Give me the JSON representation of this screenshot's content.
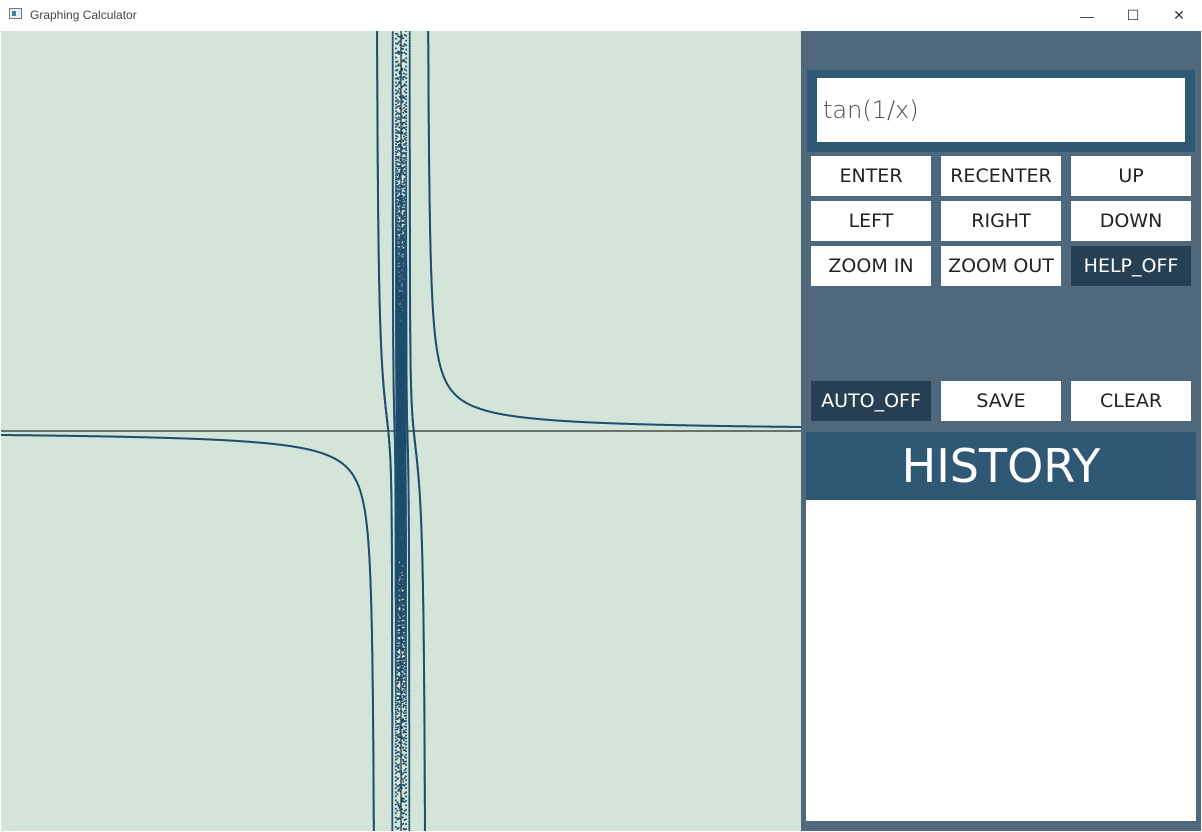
{
  "window": {
    "title": "Graphing Calculator",
    "minimize_glyph": "—",
    "maximize_glyph": "☐",
    "close_glyph": "✕"
  },
  "input": {
    "value": "tan(1/x)"
  },
  "buttons": {
    "enter": "ENTER",
    "recenter": "RECENTER",
    "up": "UP",
    "left": "LEFT",
    "right": "RIGHT",
    "down": "DOWN",
    "zoom_in": "ZOOM IN",
    "zoom_out": "ZOOM OUT",
    "help": "HELP_OFF",
    "auto": "AUTO_OFF",
    "save": "SAVE",
    "clear": "CLEAR"
  },
  "history": {
    "title": "HISTORY",
    "items": []
  },
  "colors": {
    "plot_background": "#d3e5d9",
    "curve": "#1f4e6e",
    "panel": "#50687c",
    "accent": "#2f5875",
    "toggle_off": "#263f52"
  },
  "chart_data": {
    "type": "scatter",
    "function": "tan(1/x)",
    "xlim": [
      -10,
      10
    ],
    "ylim": [
      -10,
      10
    ],
    "grid": false
  }
}
